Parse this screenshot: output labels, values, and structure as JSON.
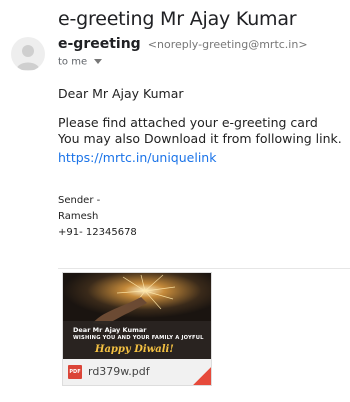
{
  "email": {
    "subject": "e-greeting Mr Ajay Kumar",
    "sender_name": "e-greeting",
    "sender_email": "<noreply-greeting@mrtc.in>",
    "to_label": "to me",
    "greeting": "Dear Mr Ajay Kumar",
    "line1": "Please find attached your e-greeting card",
    "line2": "You may also Download it from following link.",
    "link": "https://mrtc.in/uniquelink",
    "signature": {
      "label": "Sender -",
      "name": "Ramesh",
      "phone": "+91- 12345678"
    }
  },
  "attachment": {
    "file_name": "rd379w.pdf",
    "file_type_badge": "PDF",
    "thumbnail": {
      "line1": "Dear Mr Ajay Kumar",
      "line2": "WISHING YOU AND YOUR FAMILY A JOYFUL",
      "line3": "Happy Diwali!"
    }
  },
  "icons": {
    "avatar": "person-icon",
    "caret": "caret-down-icon",
    "pdf": "pdf-icon"
  },
  "colors": {
    "link": "#1a73e8",
    "pdf_badge": "#db4437",
    "greeting_text": "#f5c242"
  }
}
